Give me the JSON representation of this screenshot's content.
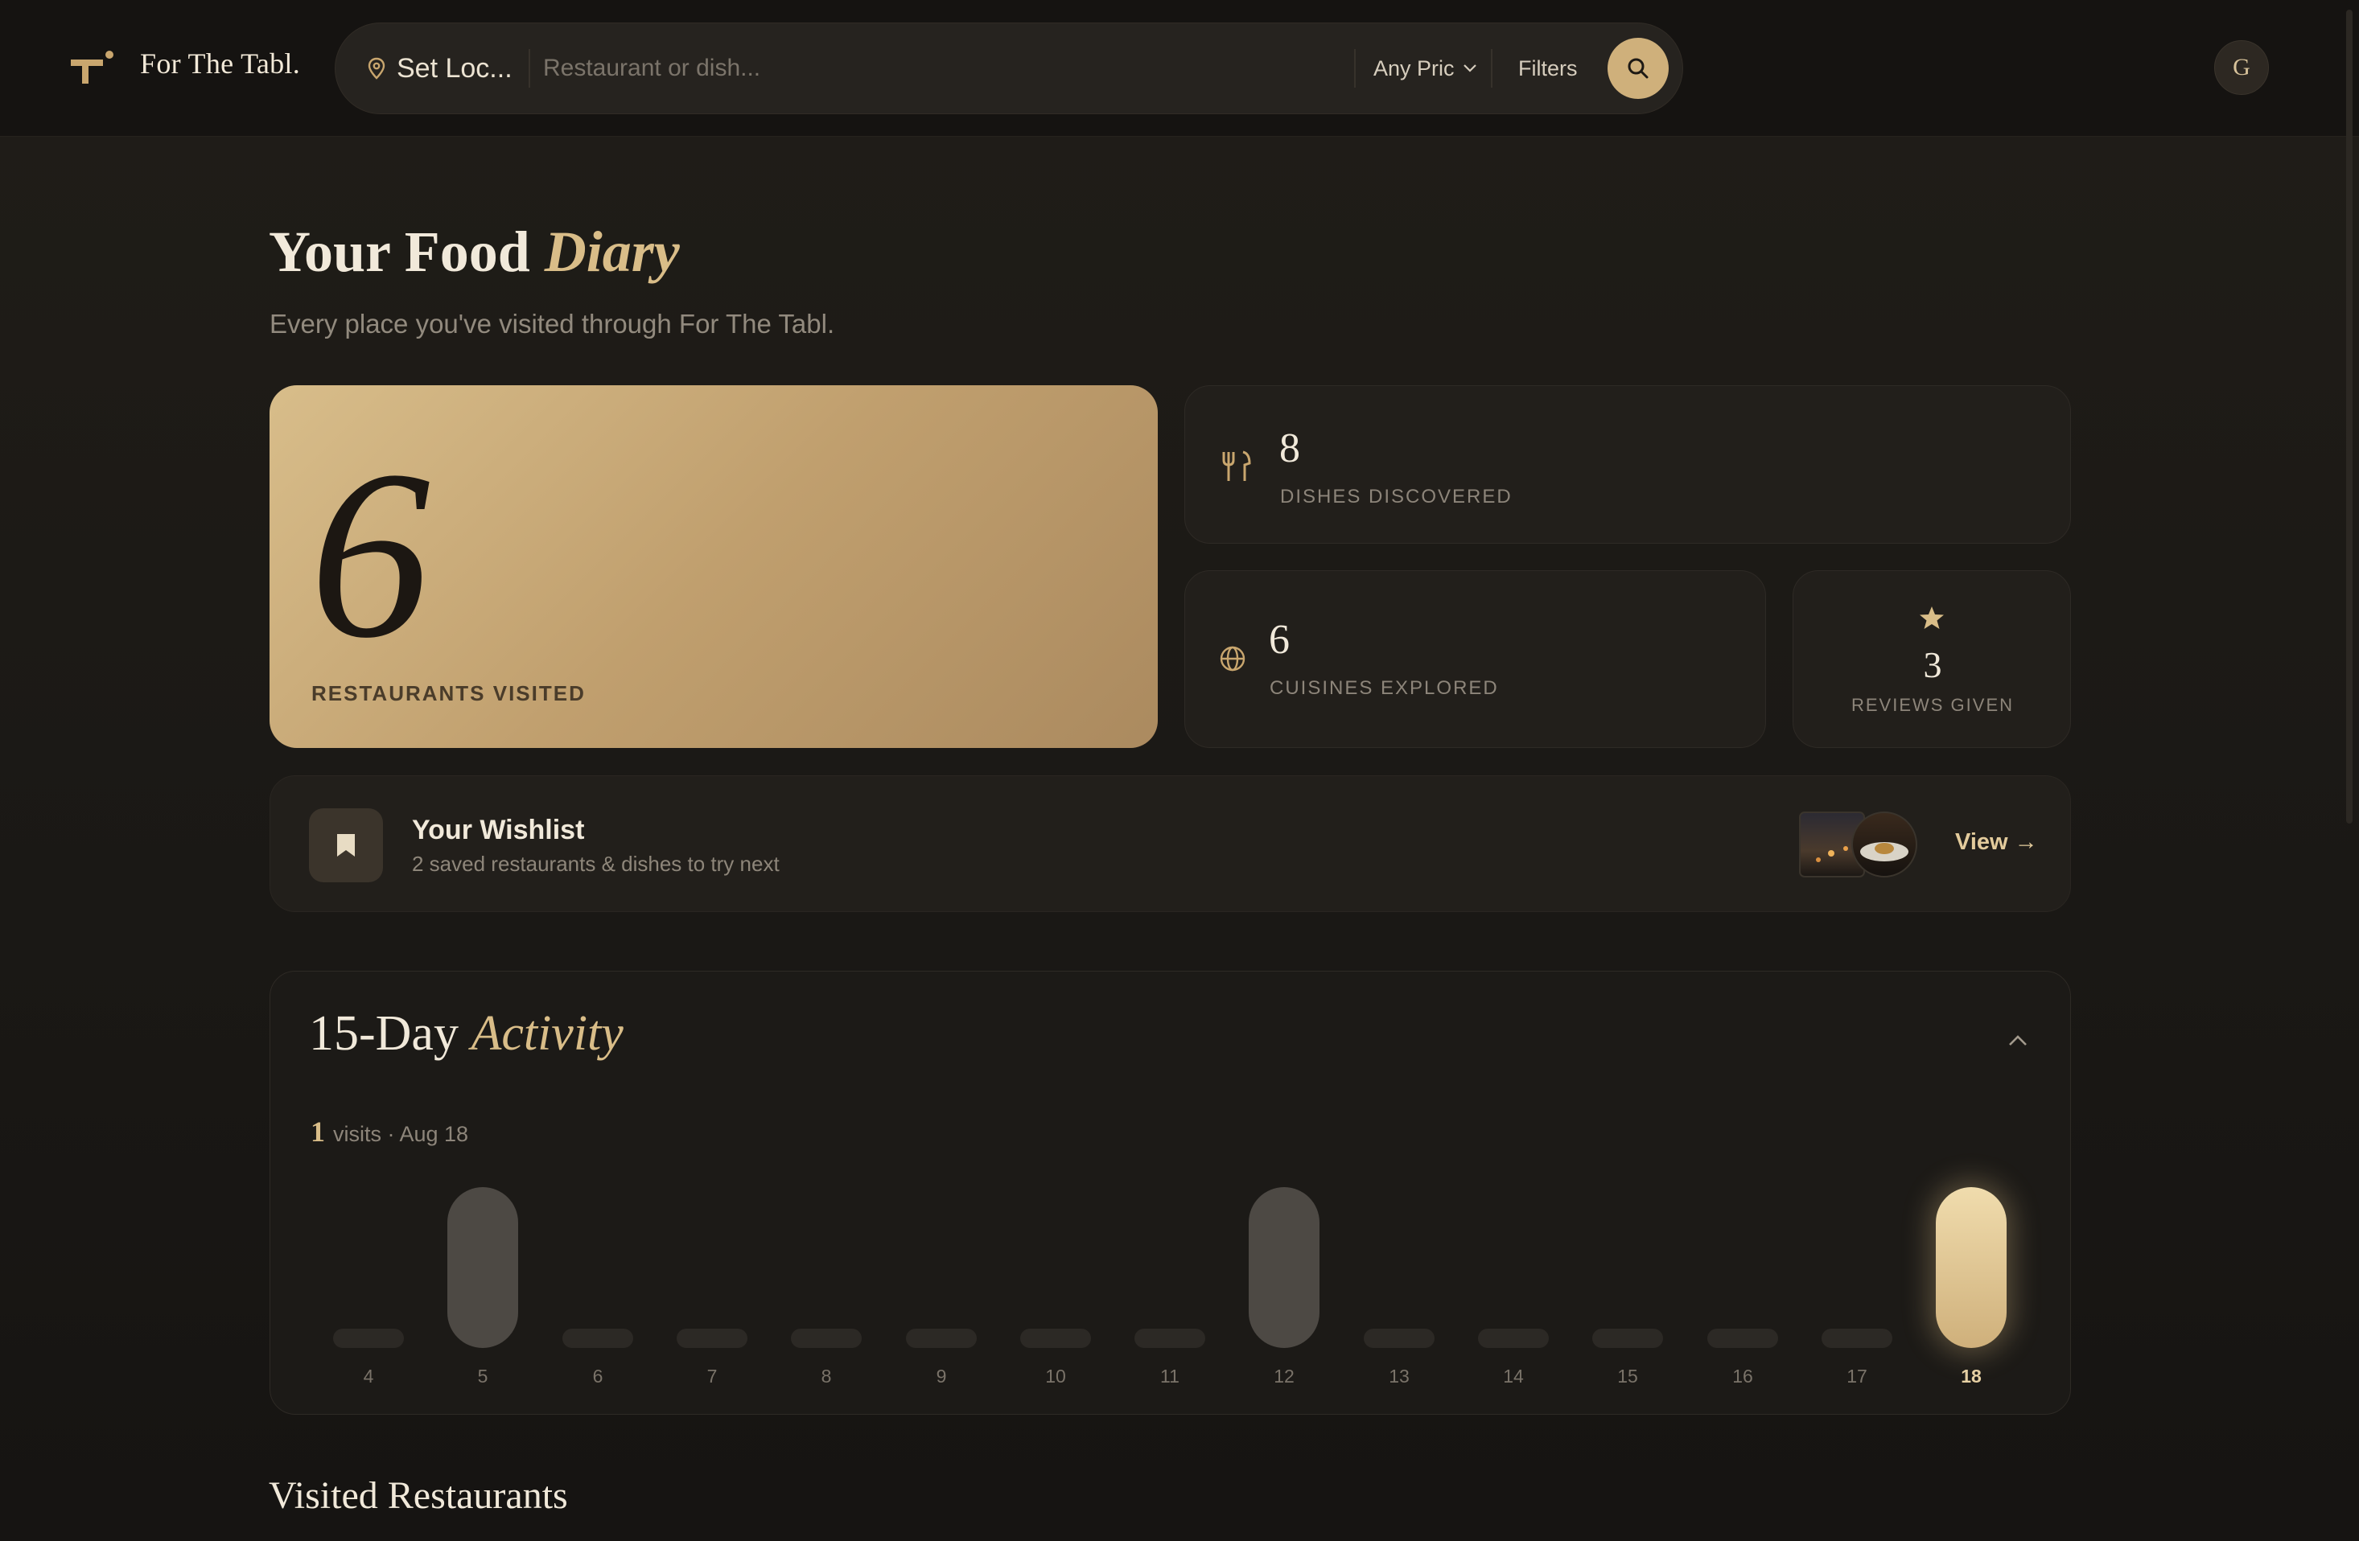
{
  "brand": {
    "name": "For The Tabl."
  },
  "header": {
    "location_label": "Set Loc...",
    "search_placeholder": "Restaurant or dish...",
    "price_label": "Any Pric",
    "filters_label": "Filters",
    "avatar_initial": "G"
  },
  "page": {
    "title_main": "Your Food ",
    "title_accent": "Diary",
    "subtitle": "Every place you've visited through For The Tabl."
  },
  "stats": {
    "restaurants": {
      "value": "6",
      "label": "RESTAURANTS VISITED"
    },
    "dishes": {
      "value": "8",
      "label": "DISHES DISCOVERED"
    },
    "cuisines": {
      "value": "6",
      "label": "CUISINES EXPLORED"
    },
    "reviews": {
      "value": "3",
      "label": "REVIEWS GIVEN"
    }
  },
  "wishlist": {
    "title": "Your Wishlist",
    "subtitle": "2 saved restaurants & dishes to try next",
    "view_label": "View →"
  },
  "activity": {
    "title_main": "15-Day ",
    "title_accent": "Activity",
    "selected_count": "1",
    "selected_desc": "visits · Aug 18",
    "days": [
      {
        "label": "4",
        "visits": 0
      },
      {
        "label": "5",
        "visits": 1
      },
      {
        "label": "6",
        "visits": 0
      },
      {
        "label": "7",
        "visits": 0
      },
      {
        "label": "8",
        "visits": 0
      },
      {
        "label": "9",
        "visits": 0
      },
      {
        "label": "10",
        "visits": 0
      },
      {
        "label": "11",
        "visits": 0
      },
      {
        "label": "12",
        "visits": 1
      },
      {
        "label": "13",
        "visits": 0
      },
      {
        "label": "14",
        "visits": 0
      },
      {
        "label": "15",
        "visits": 0
      },
      {
        "label": "16",
        "visits": 0
      },
      {
        "label": "17",
        "visits": 0
      },
      {
        "label": "18",
        "visits": 1,
        "today": true
      }
    ]
  },
  "visited": {
    "title": "Visited Restaurants"
  },
  "colors": {
    "accent_gold": "#d9bd88",
    "background": "#1a1815",
    "card": "#221f1b"
  }
}
